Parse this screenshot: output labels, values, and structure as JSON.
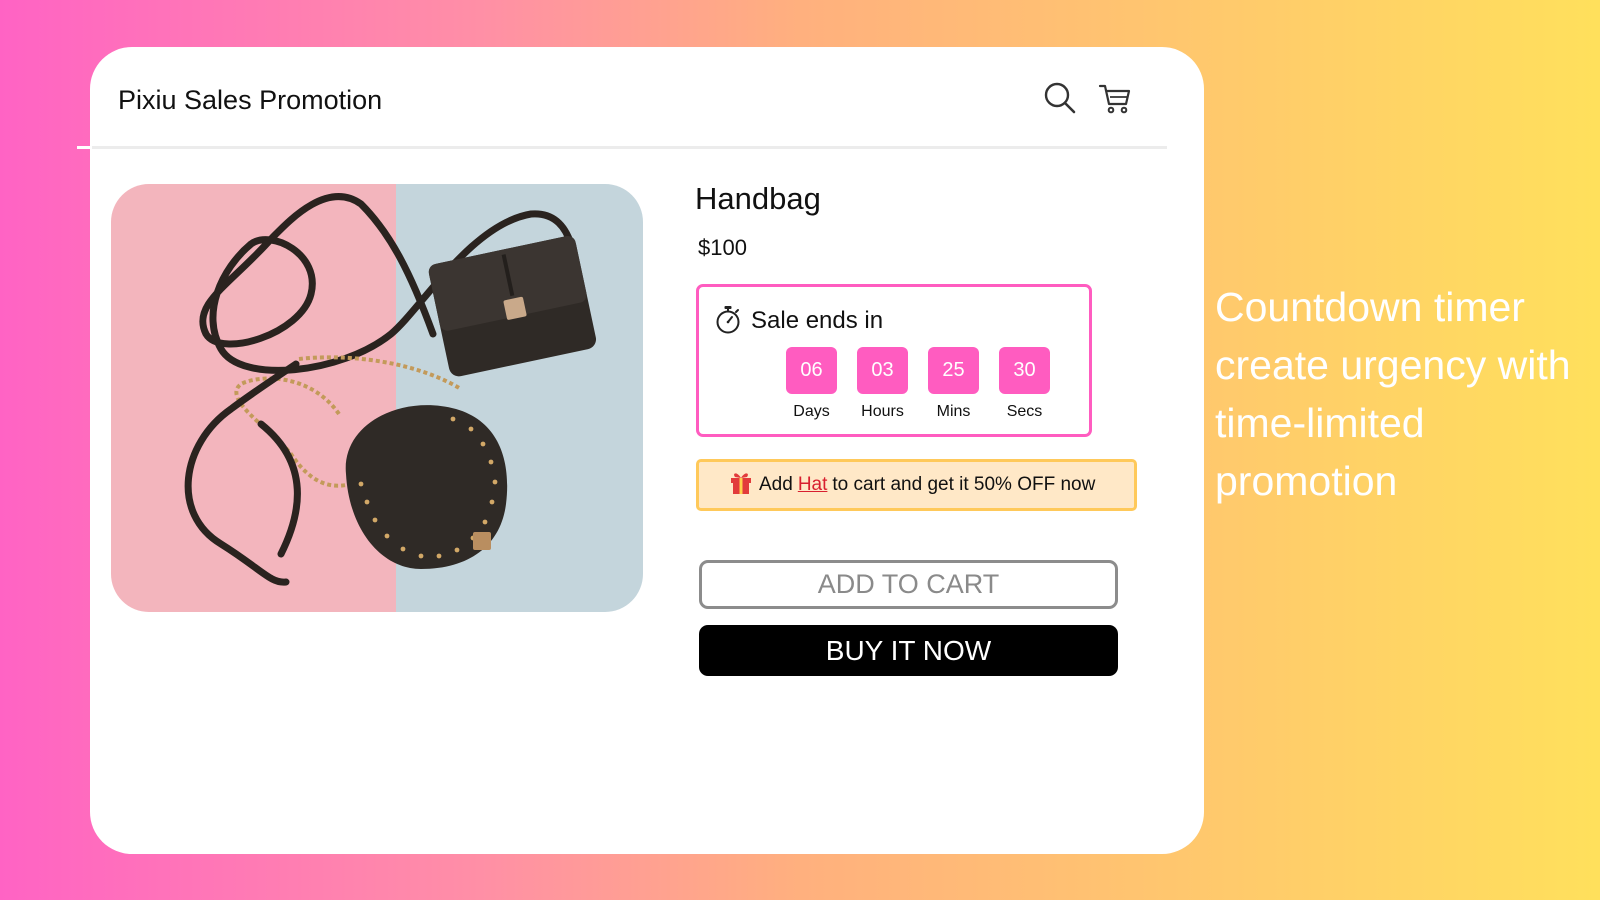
{
  "header": {
    "store_title": "Pixiu Sales Promotion",
    "icons": [
      "search-icon",
      "cart-icon"
    ]
  },
  "product": {
    "name": "Handbag",
    "price": "$100",
    "image_alt": "two-handbags-photo"
  },
  "countdown": {
    "icon": "stopwatch-icon",
    "label": "Sale ends in",
    "units": [
      {
        "value": "06",
        "label": "Days"
      },
      {
        "value": "03",
        "label": "Hours"
      },
      {
        "value": "25",
        "label": "Mins"
      },
      {
        "value": "30",
        "label": "Secs"
      }
    ]
  },
  "gift_offer": {
    "icon": "gift-icon",
    "prefix": "Add",
    "link_text": "Hat",
    "suffix": "to cart and get it 50% OFF now"
  },
  "buttons": {
    "add_to_cart": "ADD TO CART",
    "buy_now": "BUY IT NOW"
  },
  "tagline": "Countdown timer create urgency with time-limited promotion",
  "colors": {
    "accent_pink": "#ff5cc0",
    "gift_background": "#ffe8c7",
    "gift_border": "#ffc95a",
    "link_red": "#d81f2f",
    "buy_now_background": "#000000"
  }
}
